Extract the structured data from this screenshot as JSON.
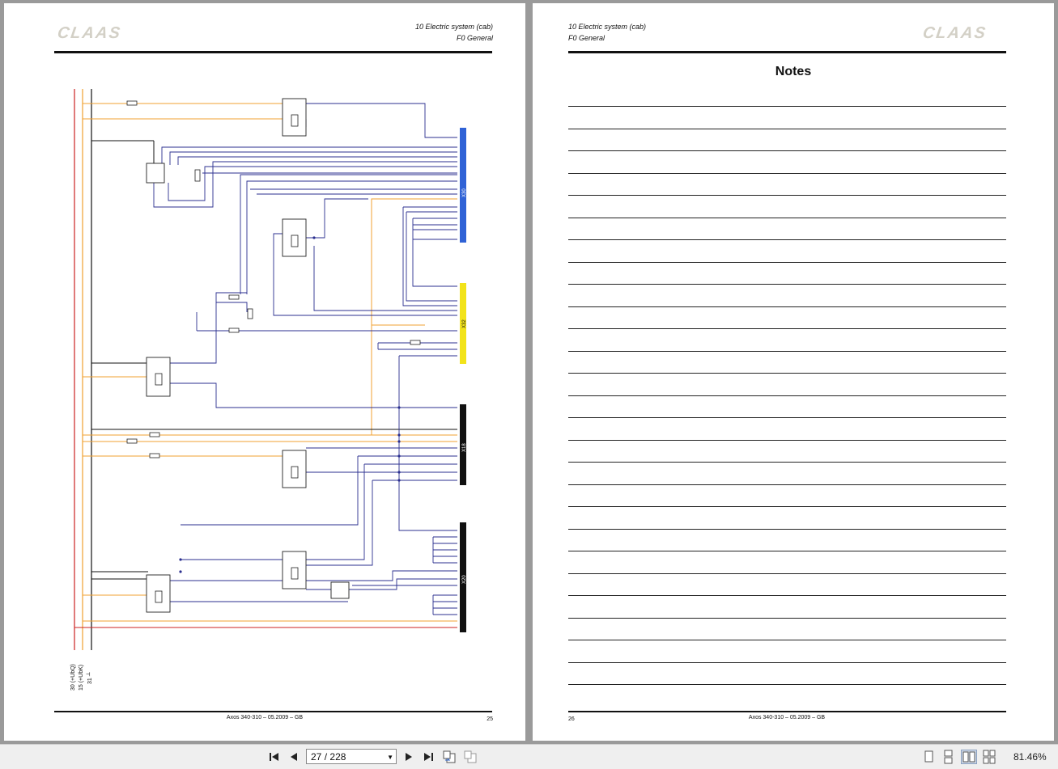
{
  "viewer": {
    "page_current": "27",
    "page_separator": "/",
    "page_total": "228",
    "zoom": "81.46%"
  },
  "left_page": {
    "logo": "CLAAS",
    "header_line1": "10 Electric system  (cab)",
    "header_line2": "F0 General",
    "footer_center": "Axos 340-310 – 05.2009 – GB",
    "page_number": "25",
    "diagram": {
      "connectors": [
        {
          "label": "X30",
          "color": "#2f62d6"
        },
        {
          "label": "X32",
          "color": "#f2e31a"
        },
        {
          "label": "X18",
          "color": "#111111"
        },
        {
          "label": "X20",
          "color": "#111111"
        }
      ],
      "supply_labels": [
        "30 (+UbQ)",
        "15 (+UbK)",
        "31 ┴"
      ],
      "colors": {
        "wire_blue": "#2b2f8f",
        "wire_orange": "#f0a030",
        "wire_red": "#cc2222",
        "wire_black": "#111111"
      }
    }
  },
  "right_page": {
    "logo": "CLAAS",
    "header_line1": "10 Electric system  (cab)",
    "header_line2": "F0 General",
    "title": "Notes",
    "footer_center": "Axos 340-310 – 05.2009 – GB",
    "page_number": "26",
    "line_count": 27
  }
}
